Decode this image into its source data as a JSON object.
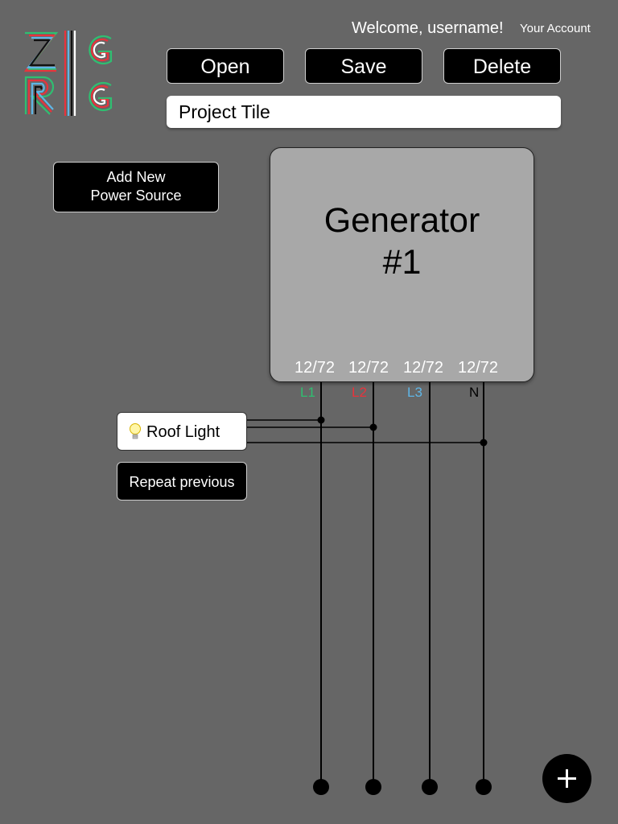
{
  "header": {
    "logo": "ZIG RIG",
    "welcome": "Welcome, username!",
    "account_link": "Your Account"
  },
  "toolbar": {
    "open_label": "Open",
    "save_label": "Save",
    "delete_label": "Delete"
  },
  "project": {
    "title": "Project Tile"
  },
  "sidebar": {
    "add_power_line1": "Add New",
    "add_power_line2": "Power Source"
  },
  "generator": {
    "name_line1": "Generator",
    "name_line2": "#1",
    "loads": [
      "12/72",
      "12/72",
      "12/72",
      "12/72"
    ],
    "phases": [
      {
        "label": "L1",
        "color": "#2fbf71"
      },
      {
        "label": "L2",
        "color": "#e8333c"
      },
      {
        "label": "L3",
        "color": "#5fb6e6"
      },
      {
        "label": "N",
        "color": "#000000"
      }
    ]
  },
  "devices": [
    {
      "label": "Roof Light",
      "icon": "lightbulb-icon"
    }
  ],
  "actions": {
    "repeat_label": "Repeat previous",
    "fab_icon": "plus-icon"
  }
}
